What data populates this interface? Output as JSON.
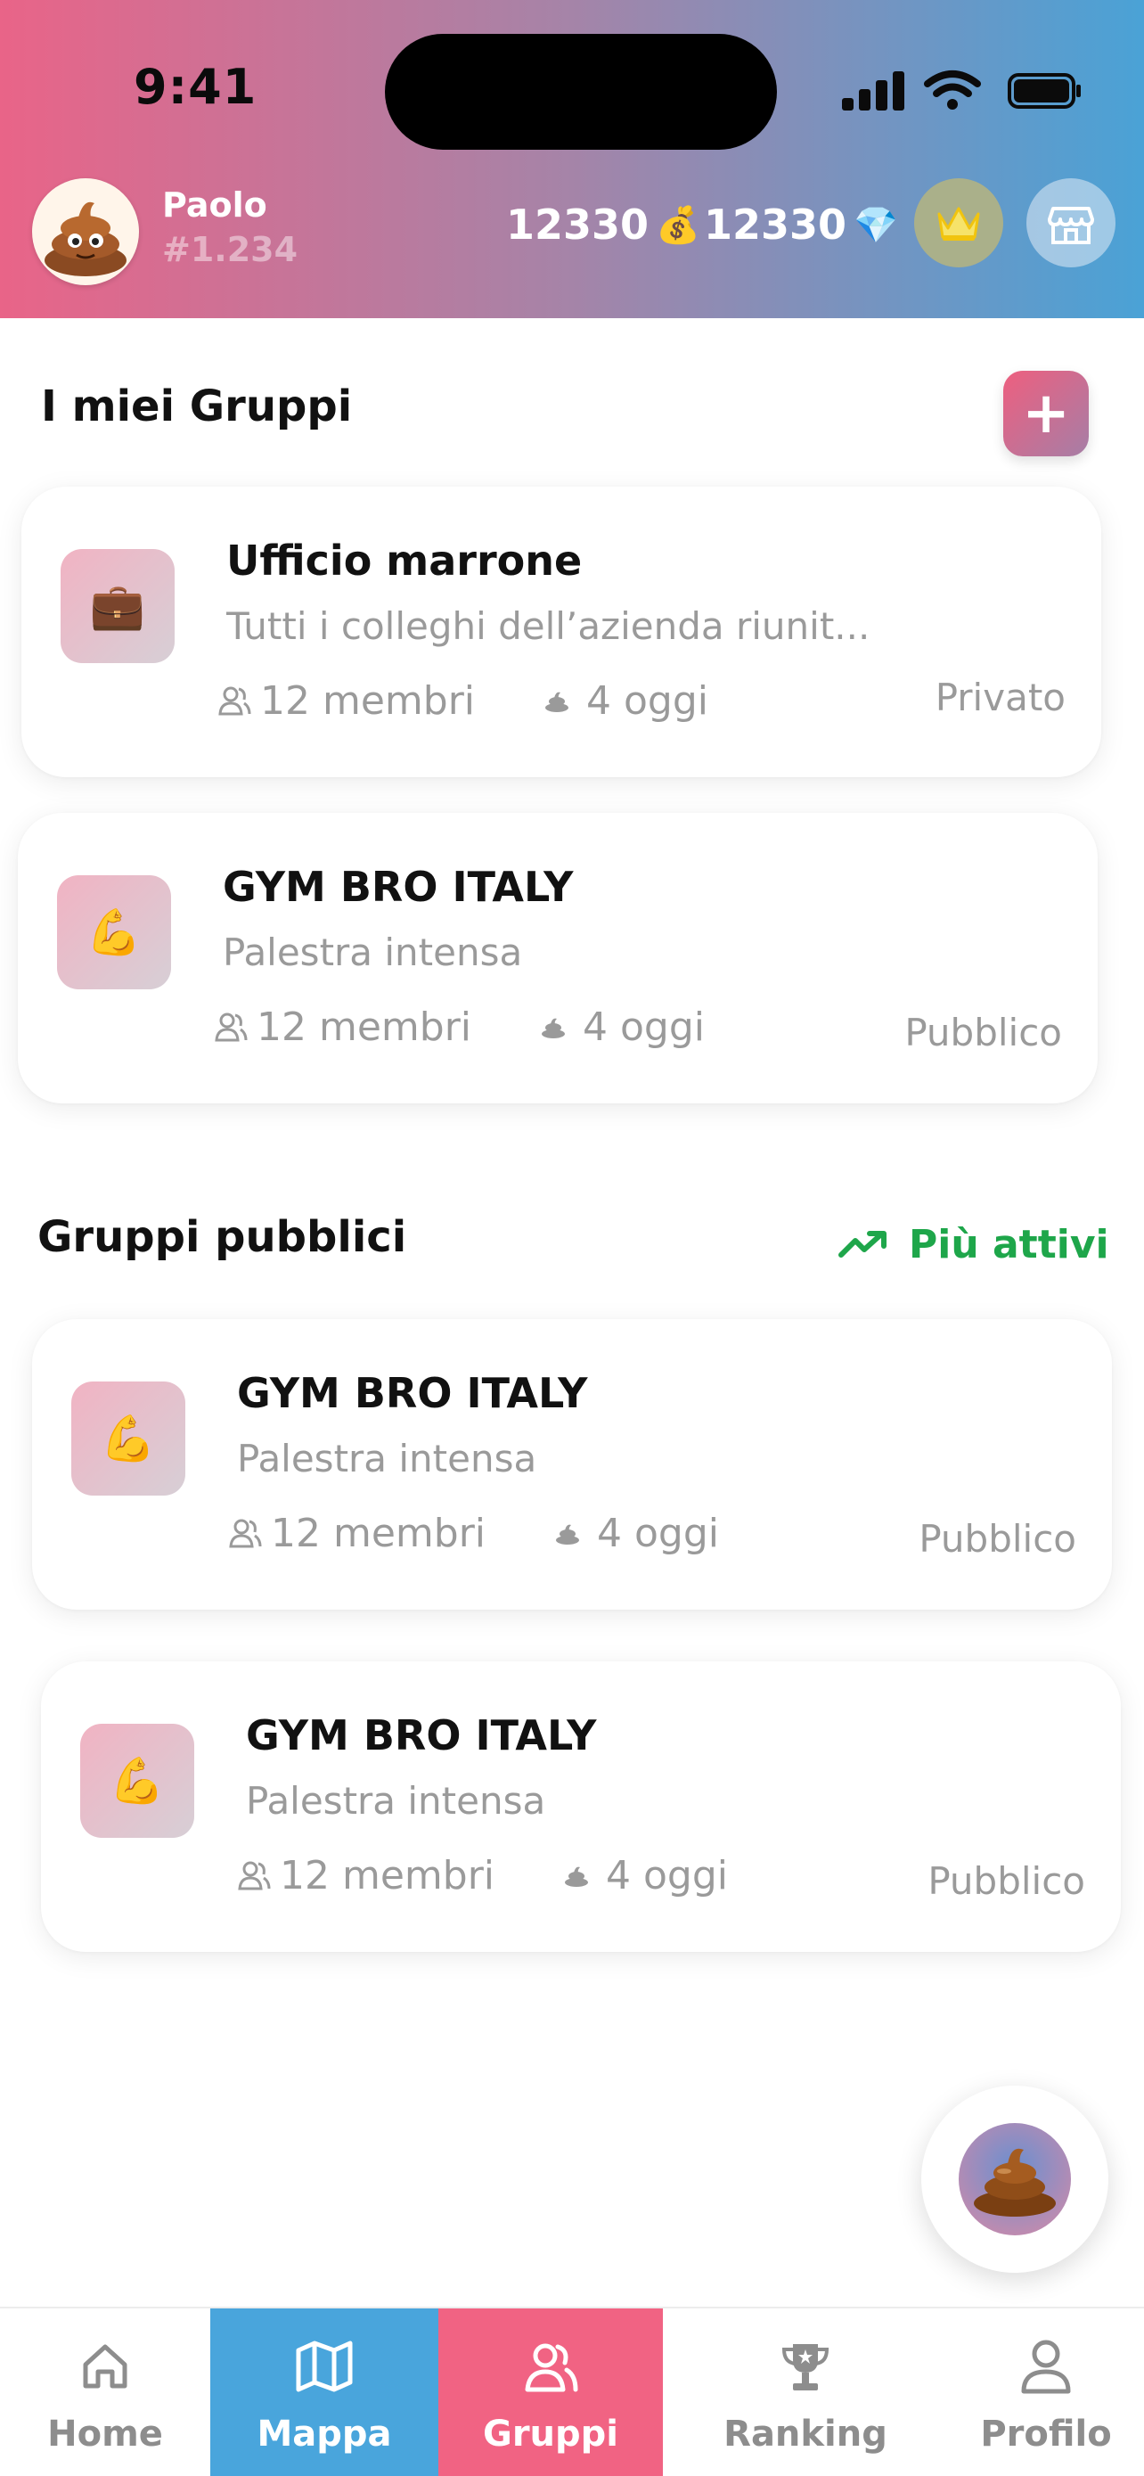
{
  "status_bar": {
    "time": "9:41"
  },
  "user": {
    "name": "Paolo",
    "id": "#1.234"
  },
  "wallet": {
    "coins": "12330",
    "coins_icon": "money-bag-icon",
    "gems": "12330",
    "gems_icon": "gem-icon"
  },
  "header_buttons": [
    "crown-icon",
    "shop-icon"
  ],
  "my_groups": {
    "title": "I miei Gruppi",
    "add_label": "+",
    "groups": [
      {
        "name": "Ufficio marrone",
        "description": "Tutti i colleghi dell’azienda riunit...",
        "members": "12 membri",
        "today": "4 oggi",
        "privacy": "Privato",
        "icon": "briefcase-icon",
        "emoji": "💼"
      },
      {
        "name": "GYM BRO ITALY",
        "description": "Palestra intensa",
        "members": "12 membri",
        "today": "4 oggi",
        "privacy": "Pubblico",
        "icon": "flexed-biceps-icon",
        "emoji": "💪"
      }
    ]
  },
  "public_groups": {
    "title": "Gruppi pubblici",
    "filter_label": "Più attivi",
    "groups": [
      {
        "name": "GYM BRO ITALY",
        "description": "Palestra intensa",
        "members": "12 membri",
        "today": "4 oggi",
        "privacy": "Pubblico",
        "icon": "flexed-biceps-icon",
        "emoji": "💪"
      },
      {
        "name": "GYM BRO ITALY",
        "description": "Palestra intensa",
        "members": "12 membri",
        "today": "4 oggi",
        "privacy": "Pubblico",
        "icon": "flexed-biceps-icon",
        "emoji": "💪"
      }
    ]
  },
  "tabs": [
    {
      "label": "Home",
      "icon": "home-icon",
      "state": "inactive"
    },
    {
      "label": "Mappa",
      "icon": "map-icon",
      "state": "highlighted"
    },
    {
      "label": "Gruppi",
      "icon": "groups-icon",
      "state": "active"
    },
    {
      "label": "Ranking",
      "icon": "trophy-icon",
      "state": "inactive"
    },
    {
      "label": "Profilo",
      "icon": "profile-icon",
      "state": "inactive"
    }
  ],
  "colors": {
    "header_gradient": [
      "#e96488",
      "#a584a8",
      "#4aa2d6"
    ],
    "accent_pink": "#f16383",
    "accent_blue": "#49a5dc",
    "trend_green": "#1ea64a"
  }
}
